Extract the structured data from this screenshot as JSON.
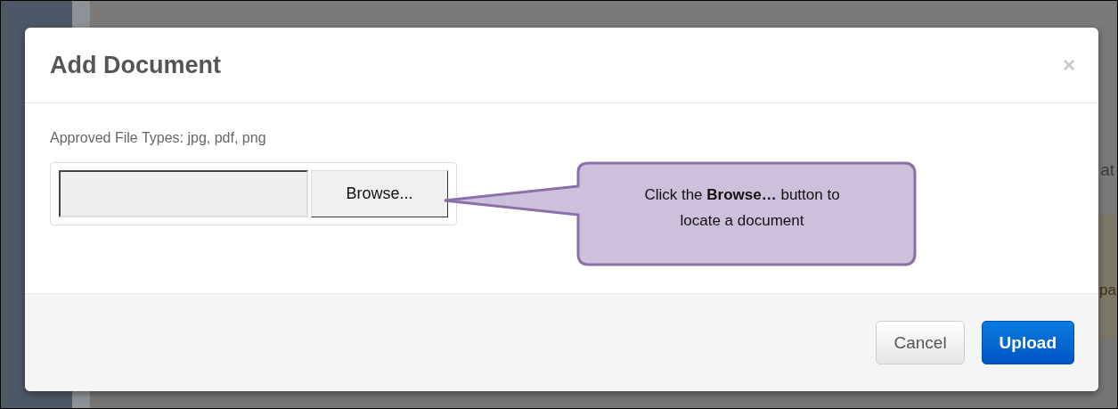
{
  "backdrop": {
    "fragments": [
      "at",
      "pa"
    ]
  },
  "dialog": {
    "title": "Add Document",
    "close": "×",
    "label": "Approved File Types: jpg, pdf, png",
    "file_input": {
      "button": "Browse..."
    },
    "buttons": [
      {
        "label": "Cancel",
        "kind": "default"
      },
      {
        "label": "Upload",
        "kind": "primary"
      }
    ]
  },
  "callout": {
    "text": "Click the **Browse…** button to locate a document"
  }
}
